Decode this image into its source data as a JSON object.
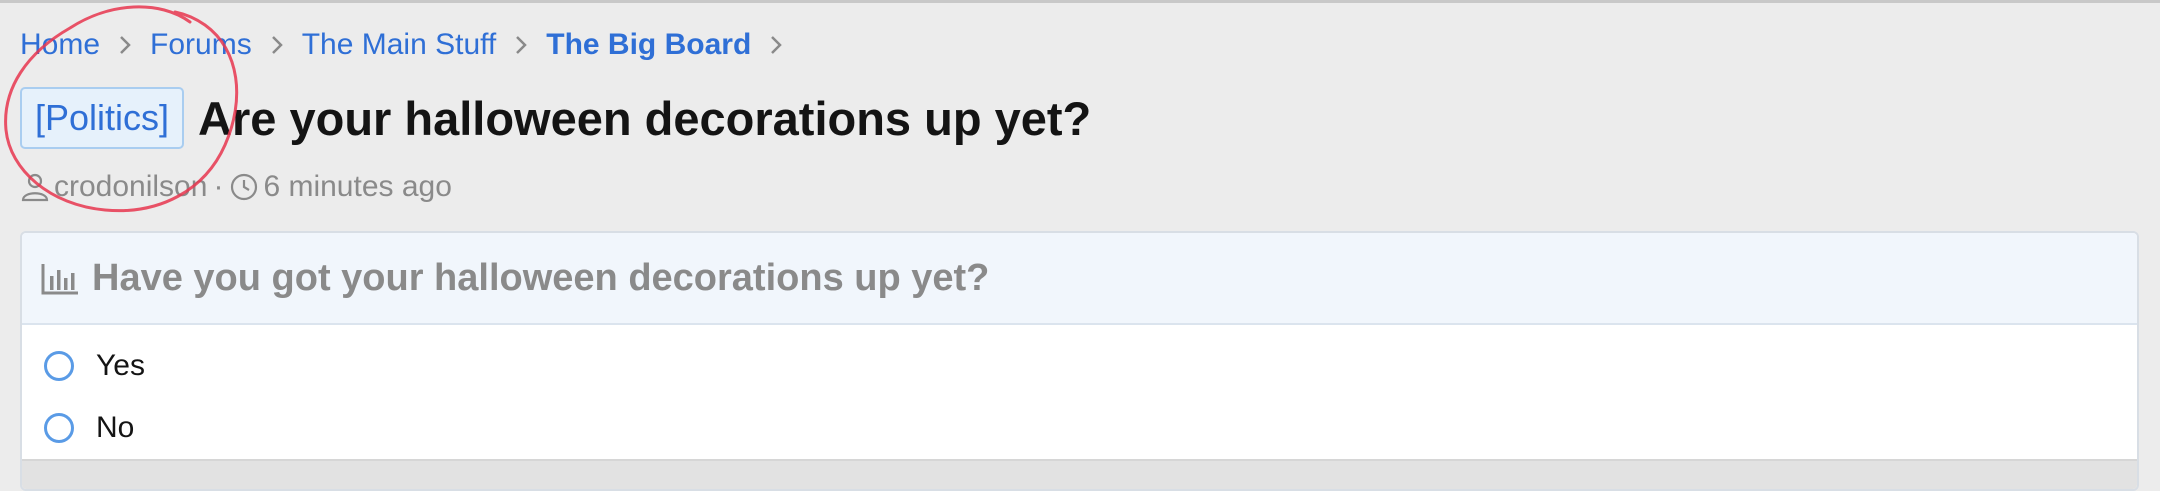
{
  "breadcrumb": {
    "items": [
      {
        "label": "Home"
      },
      {
        "label": "Forums"
      },
      {
        "label": "The Main Stuff"
      },
      {
        "label": "The Big Board"
      }
    ]
  },
  "thread": {
    "prefix": "[Politics]",
    "title": "Are your halloween decorations up yet?",
    "author": "crodonilson",
    "separator": "·",
    "time": "6 minutes ago"
  },
  "poll": {
    "icon": "bar-chart-icon",
    "question": "Have you got your halloween decorations up yet?",
    "options": [
      {
        "label": "Yes"
      },
      {
        "label": "No"
      }
    ]
  },
  "colors": {
    "link": "#2f6fd6",
    "annotation": "#e8364f",
    "radio": "#5a9be6"
  },
  "icons": {
    "author": "user-icon",
    "time": "clock-icon",
    "breadcrumb_separator": "chevron-right-icon"
  }
}
